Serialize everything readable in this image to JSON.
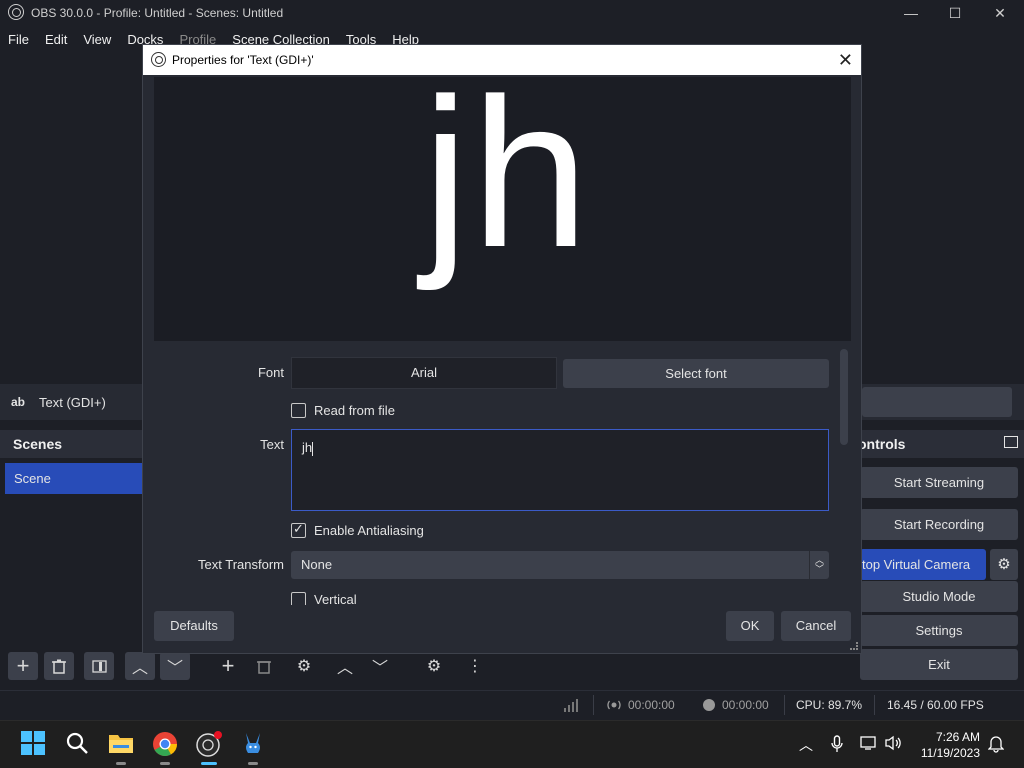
{
  "window": {
    "title": "OBS 30.0.0 - Profile: Untitled - Scenes: Untitled",
    "minimize": "—",
    "maximize": "☐",
    "close": "✕"
  },
  "menu": [
    "File",
    "Edit",
    "View",
    "Docks",
    "Profile",
    "Scene Collection",
    "Tools",
    "Help"
  ],
  "source_bar": {
    "icon_text": "ab",
    "source_name": "Text (GDI+)"
  },
  "scenes": {
    "header": "Scenes",
    "items": [
      "Scene"
    ]
  },
  "controls": {
    "header": "ontrols",
    "start_streaming": "Start Streaming",
    "start_recording": "Start Recording",
    "virtual_camera": "top Virtual Camera",
    "studio_mode": "Studio Mode",
    "settings": "Settings",
    "exit": "Exit"
  },
  "dialog": {
    "title": "Properties for 'Text (GDI+)'",
    "close": "✕",
    "preview_text": "jh",
    "font_label": "Font",
    "font_value": "Arial",
    "select_font": "Select font",
    "read_from_file": "Read from file",
    "text_label": "Text",
    "text_value": "jh",
    "enable_antialiasing": "Enable Antialiasing",
    "text_transform_label": "Text Transform",
    "text_transform_value": "None",
    "vertical": "Vertical",
    "defaults": "Defaults",
    "ok": "OK",
    "cancel": "Cancel"
  },
  "status": {
    "stream_time": "00:00:00",
    "record_time": "00:00:00",
    "cpu": "CPU: 89.7%",
    "fps": "16.45 / 60.00 FPS"
  },
  "taskbar": {
    "time": "7:26 AM",
    "date": "11/19/2023"
  },
  "colors": {
    "accent": "#284cb8",
    "background": "#1d1f26",
    "dialog": "#272a33",
    "button": "#3c404b",
    "focus": "#3b5bc8"
  }
}
